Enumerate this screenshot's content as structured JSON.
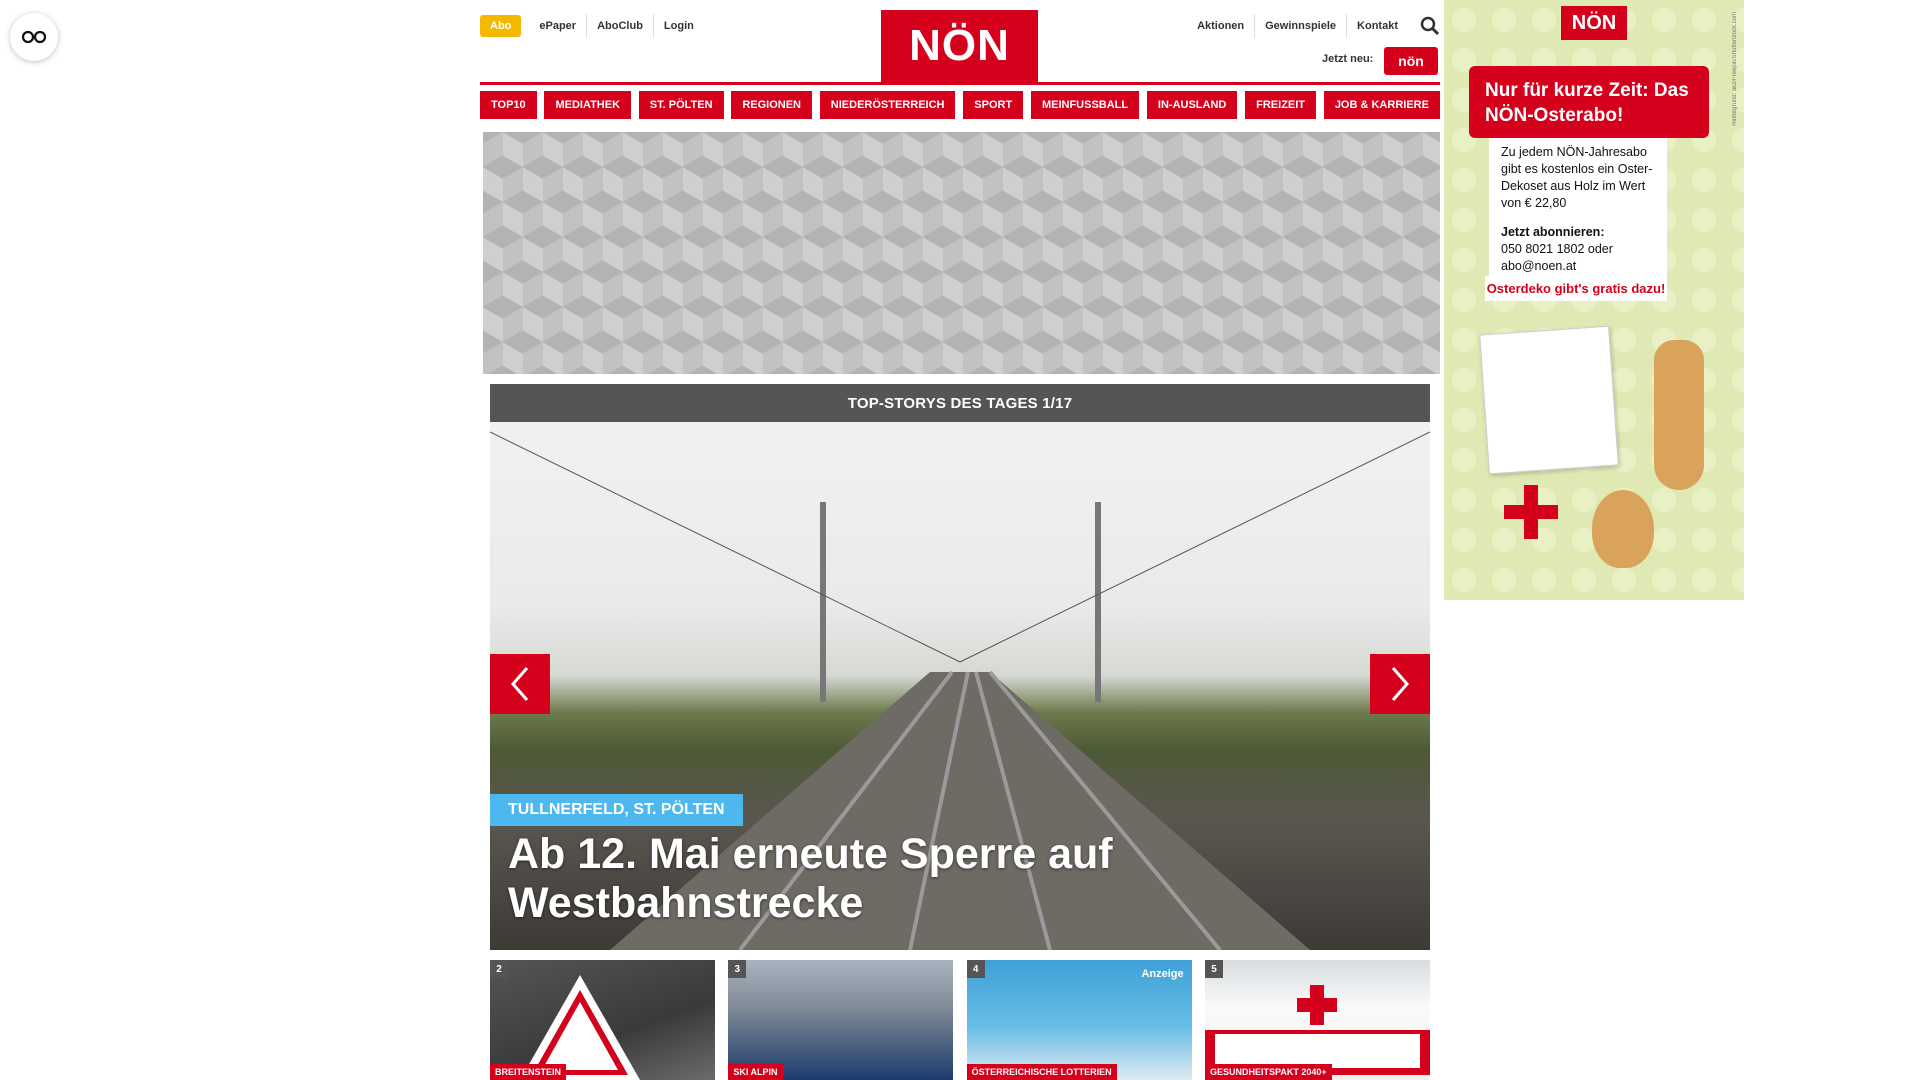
{
  "header": {
    "abo_label": "Abo",
    "links_left": [
      "ePaper",
      "AboClub",
      "Login"
    ],
    "logo_text": "NÖN",
    "links_right": [
      "Aktionen",
      "Gewinnspiele",
      "Kontakt"
    ],
    "jetzt_neu": "Jetzt neu:",
    "app_badge": "nön"
  },
  "nav": {
    "items": [
      "TOP10",
      "MEDIATHEK",
      "ST. PÖLTEN",
      "REGIONEN",
      "NIEDERÖSTERREICH",
      "SPORT",
      "MEINFUSSBALL",
      "IN-AUSLAND",
      "FREIZEIT",
      "JOB & KARRIERE"
    ]
  },
  "slider": {
    "heading": "TOP-STORYS DES TAGES 1/17",
    "tag": "TULLNERFELD, ST. PÖLTEN",
    "title": "Ab 12. Mai erneute Sperre auf Westbahnstrecke"
  },
  "teasers": [
    {
      "num": "2",
      "tag": "BREITENSTEIN"
    },
    {
      "num": "3",
      "tag": "SKI ALPIN"
    },
    {
      "num": "4",
      "tag": "ÖSTERREICHISCHE LOTTERIEN",
      "badge": "Anzeige"
    },
    {
      "num": "5",
      "tag": "GESUNDHEITSPAKT 2040+"
    }
  ],
  "side_ad": {
    "logo": "NÖN",
    "headline": "Nur für kurze Zeit: Das NÖN-Osterabo!",
    "body1": "Zu jedem NÖN-Jahresabo gibt es kostenlos ein Oster-Dekoset aus Holz im Wert von € 22,80",
    "body2_label": "Jetzt abonnieren:",
    "body2": "050 8021 1802 oder abo@noen.at",
    "gratis": "Osterdeko gibt's gratis dazu!",
    "vertical_text": "Hintergrund: akz/Freepik/Shutterstock.com"
  },
  "colors": {
    "brand_red": "#d5001c",
    "abo_yellow": "#f5b800",
    "tag_blue": "#4db8ef"
  }
}
